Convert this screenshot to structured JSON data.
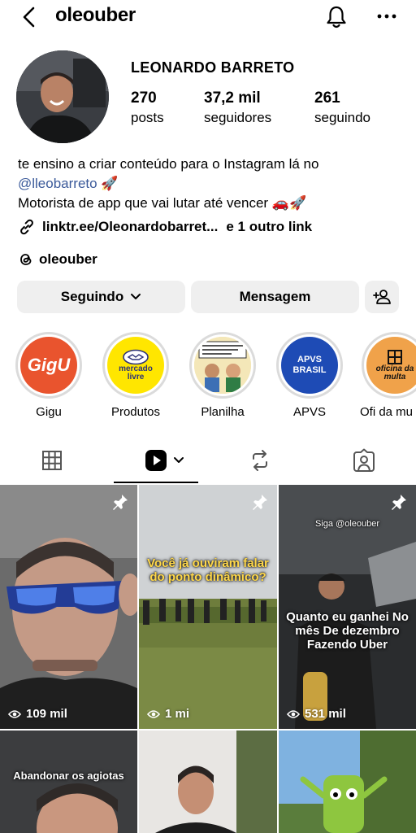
{
  "header": {
    "username": "oleouber"
  },
  "profile": {
    "full_name": "LEONARDO BARRETO",
    "stats": [
      {
        "value": "270",
        "label": "posts"
      },
      {
        "value": "37,2 mil",
        "label": "seguidores"
      },
      {
        "value": "261",
        "label": "seguindo"
      }
    ],
    "bio_line1": "te ensino a criar conteúdo para o Instagram lá no",
    "bio_mention": "@lleobarreto",
    "bio_line2": "Motorista de app que vai lutar até vencer",
    "link": "linktr.ee/Oleonardobarret...",
    "link_more": "e 1 outro link",
    "threads": "oleouber"
  },
  "actions": {
    "following": "Seguindo",
    "message": "Mensagem"
  },
  "highlights": [
    {
      "label": "Gigu",
      "badge": "GigU"
    },
    {
      "label": "Produtos",
      "badge": "mercado livre"
    },
    {
      "label": "Planilha"
    },
    {
      "label": "APVS",
      "badge": "APVS BRASIL"
    },
    {
      "label": "Ofi da mu",
      "badge": "oficina da multa"
    }
  ],
  "grid": [
    {
      "views": "109 mil",
      "pinned": true,
      "caption": ""
    },
    {
      "views": "1 mi",
      "pinned": true,
      "caption": "Você já ouviram falar do ponto dinâmico?"
    },
    {
      "views": "531 mil",
      "pinned": true,
      "caption": "Quanto eu ganhei No mês De dezembro Fazendo Uber",
      "watermark": "Siga @oleouber"
    },
    {
      "caption": "Abandonar os agiotas"
    },
    {
      "caption": ""
    },
    {
      "caption": ""
    }
  ],
  "colors": {
    "accent_link": "#3b5a9a",
    "button_bg": "#efefef"
  }
}
